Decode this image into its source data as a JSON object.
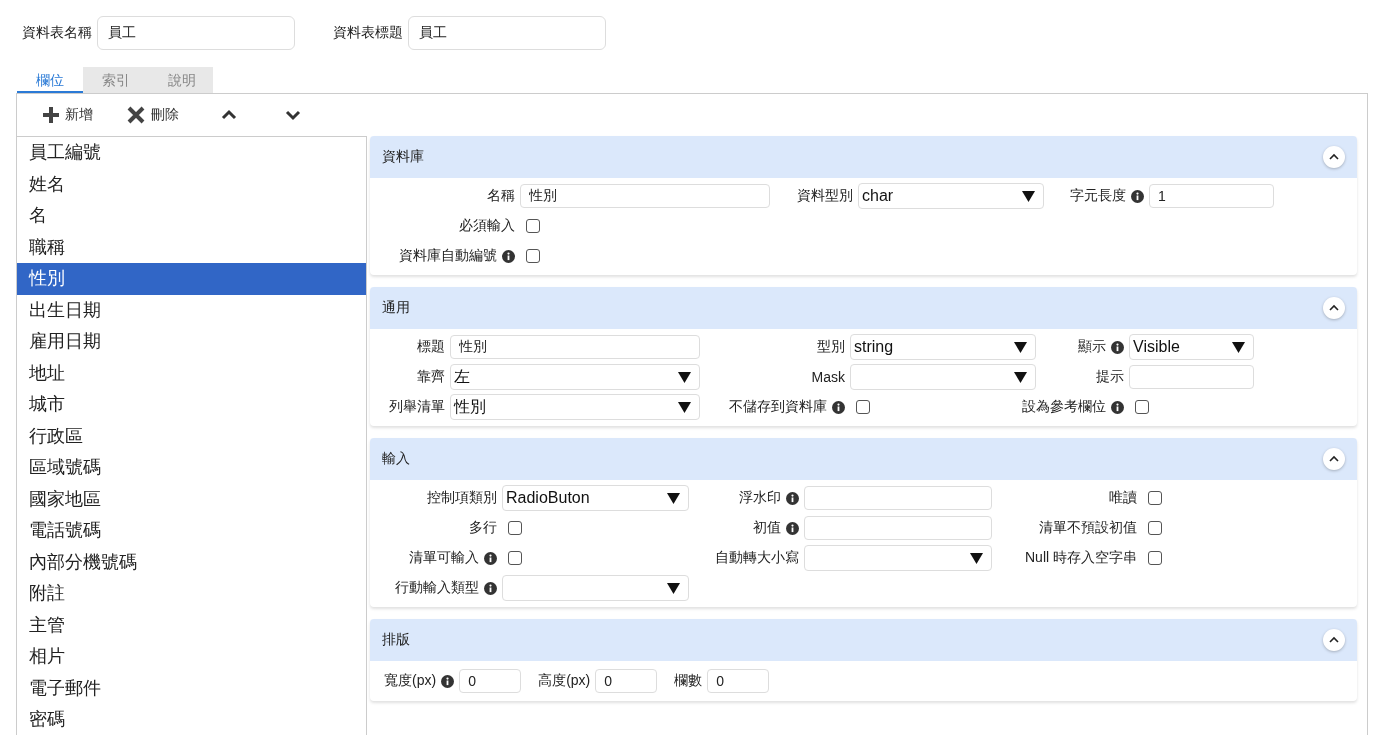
{
  "header": {
    "fields": [
      {
        "label": "資料表名稱",
        "value": "員工"
      },
      {
        "label": "資料表標題",
        "value": "員工"
      }
    ]
  },
  "tabs": [
    {
      "label": "欄位",
      "selected": true
    },
    {
      "label": "索引",
      "selected": false
    },
    {
      "label": "說明",
      "selected": false
    }
  ],
  "toolbar": [
    {
      "kind": "add",
      "label": "新增"
    },
    {
      "kind": "delete",
      "label": "刪除"
    },
    {
      "kind": "up"
    },
    {
      "kind": "down"
    }
  ],
  "field_list": [
    {
      "label": "員工編號",
      "selected": false
    },
    {
      "label": "姓名",
      "selected": false
    },
    {
      "label": "名",
      "selected": false
    },
    {
      "label": "職稱",
      "selected": false
    },
    {
      "label": "性別",
      "selected": true
    },
    {
      "label": "出生日期",
      "selected": false
    },
    {
      "label": "雇用日期",
      "selected": false
    },
    {
      "label": "地址",
      "selected": false
    },
    {
      "label": "城市",
      "selected": false
    },
    {
      "label": "行政區",
      "selected": false
    },
    {
      "label": "區域號碼",
      "selected": false
    },
    {
      "label": "國家地區",
      "selected": false
    },
    {
      "label": "電話號碼",
      "selected": false
    },
    {
      "label": "內部分機號碼",
      "selected": false
    },
    {
      "label": "附註",
      "selected": false
    },
    {
      "label": "主管",
      "selected": false
    },
    {
      "label": "相片",
      "selected": false
    },
    {
      "label": "電子郵件",
      "selected": false
    },
    {
      "label": "密碼",
      "selected": false
    }
  ],
  "sections": [
    {
      "title": "資料庫",
      "expanded": true,
      "kind": "grid",
      "rows": [
        [
          {
            "kind": "text",
            "label": "名稱",
            "info": false,
            "value": "性別"
          },
          {
            "kind": "select",
            "label": "資料型別",
            "info": false,
            "value": "char"
          },
          {
            "kind": "text",
            "label": "字元長度",
            "info": true,
            "value": "1"
          }
        ],
        [
          {
            "kind": "checkbox",
            "label": "必須輸入",
            "info": false,
            "checked": false
          }
        ],
        [
          {
            "kind": "checkbox",
            "label": "資料庫自動編號",
            "info": true,
            "checked": false
          }
        ]
      ]
    },
    {
      "title": "通用",
      "expanded": true,
      "kind": "grid",
      "rows": [
        [
          {
            "kind": "text",
            "label": "標題",
            "info": false,
            "value": "性別"
          },
          {
            "kind": "select",
            "label": "型別",
            "info": false,
            "value": "string"
          },
          {
            "kind": "select",
            "label": "顯示",
            "info": true,
            "value": "Visible"
          }
        ],
        [
          {
            "kind": "select",
            "label": "靠齊",
            "info": false,
            "value": "左"
          },
          {
            "kind": "select",
            "label": "Mask",
            "info": false
          },
          {
            "kind": "text",
            "label": "提示",
            "info": false
          }
        ],
        [
          {
            "kind": "select",
            "label": "列舉清單",
            "info": false,
            "value": "性別"
          },
          {
            "kind": "checkbox",
            "label": "不儲存到資料庫",
            "info": true,
            "checked": false
          },
          {
            "kind": "checkbox",
            "label": "設為參考欄位",
            "info": true,
            "checked": false
          }
        ]
      ]
    },
    {
      "title": "輸入",
      "expanded": true,
      "kind": "grid",
      "rows": [
        [
          {
            "kind": "select",
            "label": "控制項類別",
            "info": false,
            "value": "RadioButon"
          },
          {
            "kind": "text",
            "label": "浮水印",
            "info": true
          },
          {
            "kind": "checkbox",
            "label": "唯讀",
            "info": false,
            "checked": false
          }
        ],
        [
          {
            "kind": "checkbox",
            "label": "多行",
            "info": false,
            "checked": false
          },
          {
            "kind": "text",
            "label": "初值",
            "info": true
          },
          {
            "kind": "checkbox",
            "label": "清單不預設初值",
            "info": false,
            "checked": false
          }
        ],
        [
          {
            "kind": "checkbox",
            "label": "清單可輸入",
            "info": true,
            "checked": false
          },
          {
            "kind": "select",
            "label": "自動轉大小寫",
            "info": false
          },
          {
            "kind": "checkbox",
            "label": "Null 時存入空字串",
            "info": false,
            "checked": false
          }
        ],
        [
          {
            "kind": "select",
            "label": "行動輸入類型",
            "info": true
          }
        ]
      ]
    },
    {
      "title": "排版",
      "expanded": true,
      "kind": "inline",
      "rows": [
        [
          {
            "kind": "text",
            "label": "寬度(px)",
            "info": true,
            "value": "0"
          },
          {
            "kind": "text",
            "label": "高度(px)",
            "info": false,
            "value": "0"
          },
          {
            "kind": "text",
            "label": "欄數",
            "info": false,
            "value": "0"
          }
        ]
      ]
    }
  ]
}
